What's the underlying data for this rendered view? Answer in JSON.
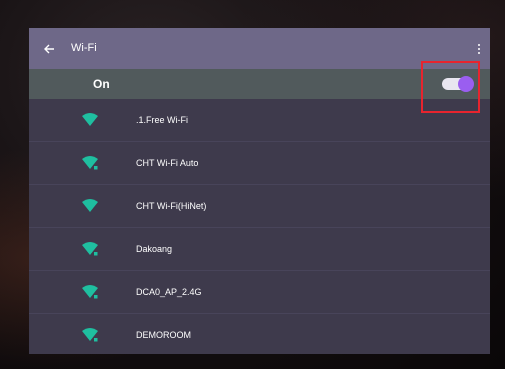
{
  "appbar": {
    "title": "Wi-Fi",
    "back_icon": "arrow-back-icon",
    "menu_icon": "more-vert-icon"
  },
  "wifi_toggle": {
    "label": "On",
    "state": "on",
    "accent_color": "#9a5ef0"
  },
  "networks": [
    {
      "name": ".1.Free Wi-Fi",
      "icon": "wifi-icon",
      "locked": false
    },
    {
      "name": "CHT Wi-Fi Auto",
      "icon": "wifi-lock-icon",
      "locked": true
    },
    {
      "name": "CHT Wi-Fi(HiNet)",
      "icon": "wifi-icon",
      "locked": false
    },
    {
      "name": "Dakoang",
      "icon": "wifi-lock-icon",
      "locked": true
    },
    {
      "name": "DCA0_AP_2.4G",
      "icon": "wifi-lock-icon",
      "locked": true
    },
    {
      "name": "DEMOROOM",
      "icon": "wifi-lock-icon",
      "locked": true
    }
  ],
  "colors": {
    "appbar": "#6e6888",
    "panel": "#3e3a4c",
    "toggle_row": "#515a5c",
    "wifi_icon": "#1fbfa0",
    "highlight": "#e8242e"
  }
}
